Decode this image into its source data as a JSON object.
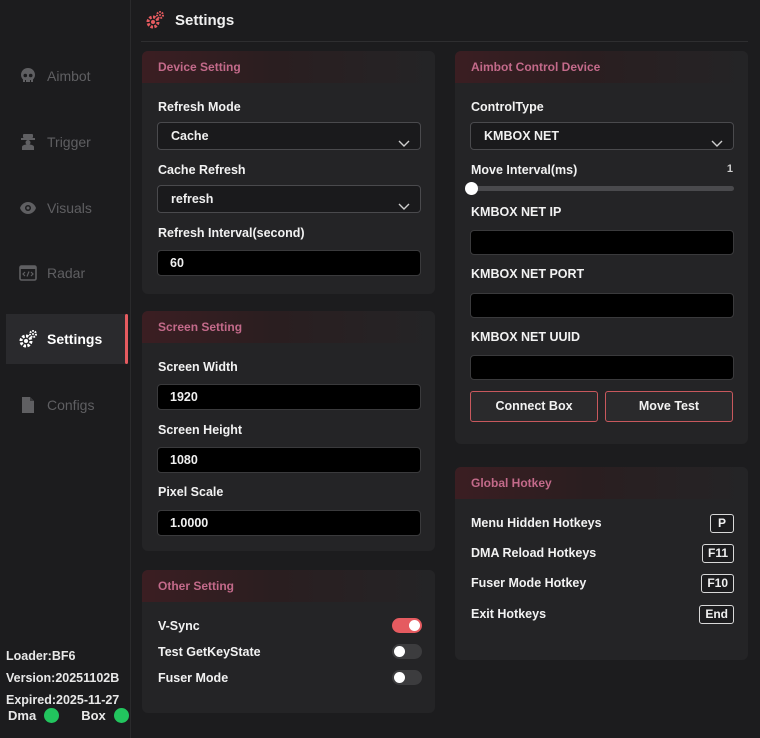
{
  "header": {
    "title": "Settings"
  },
  "sidebar": {
    "items": [
      {
        "label": "Aimbot",
        "icon": "skull-icon"
      },
      {
        "label": "Trigger",
        "icon": "soldier-icon"
      },
      {
        "label": "Visuals",
        "icon": "eye-icon"
      },
      {
        "label": "Radar",
        "icon": "code-window-icon"
      },
      {
        "label": "Settings",
        "icon": "gears-icon",
        "active": true
      },
      {
        "label": "Configs",
        "icon": "file-icon"
      }
    ],
    "footer": {
      "loader": "Loader:BF6",
      "version": "Version:20251102B",
      "expired": "Expired:2025-11-27",
      "dma_label": "Dma",
      "box_label": "Box"
    }
  },
  "device_setting": {
    "title": "Device Setting",
    "refresh_mode_label": "Refresh Mode",
    "refresh_mode_value": "Cache",
    "cache_refresh_label": "Cache Refresh",
    "cache_refresh_value": "refresh",
    "refresh_interval_label": "Refresh Interval(second)",
    "refresh_interval_value": "60"
  },
  "screen_setting": {
    "title": "Screen Setting",
    "width_label": "Screen Width",
    "width_value": "1920",
    "height_label": "Screen Height",
    "height_value": "1080",
    "scale_label": "Pixel Scale",
    "scale_value": "1.0000"
  },
  "other_setting": {
    "title": "Other Setting",
    "vsync_label": "V-Sync",
    "vsync_on": true,
    "getkeystate_label": "Test GetKeyState",
    "getkeystate_on": false,
    "fuser_label": "Fuser Mode",
    "fuser_on": false
  },
  "aimbot_device": {
    "title": "Aimbot Control Device",
    "control_type_label": "ControlType",
    "control_type_value": "KMBOX NET",
    "move_interval_label": "Move Interval(ms)",
    "move_interval_value": "1",
    "ip_label": "KMBOX NET IP",
    "ip_value": "",
    "port_label": "KMBOX NET PORT",
    "port_value": "",
    "uuid_label": "KMBOX NET UUID",
    "uuid_value": "",
    "connect_label": "Connect Box",
    "test_label": "Move Test"
  },
  "global_hotkey": {
    "title": "Global Hotkey",
    "rows": [
      {
        "label": "Menu Hidden Hotkeys",
        "key": "P"
      },
      {
        "label": "DMA Reload Hotkeys",
        "key": "F11"
      },
      {
        "label": "Fuser Mode Hotkey",
        "key": "F10"
      },
      {
        "label": "Exit Hotkeys",
        "key": "End"
      }
    ]
  },
  "colors": {
    "accent": "#e55b60",
    "title_text": "#c36a8a",
    "status_ok": "#22c55e"
  }
}
